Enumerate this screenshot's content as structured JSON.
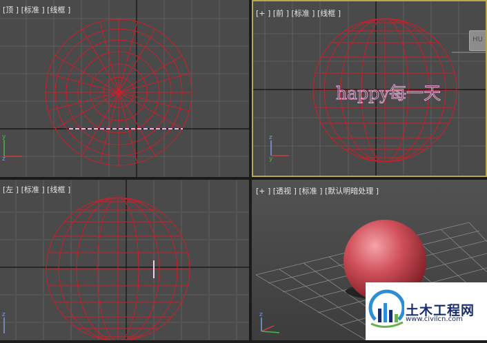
{
  "viewports": {
    "top": {
      "label": "[顶 ] [标准 ] [线框 ]"
    },
    "front": {
      "label": "[+ ] [前 ] [标准 ] [线框 ]",
      "text_object": "happy每一天"
    },
    "left": {
      "label": "[左 ] [标准 ] [线框 ]"
    },
    "persp": {
      "label": "[+ ] [透视 ] [标准 ] [默认明暗处理 ]"
    }
  },
  "colors": {
    "viewport_bg": "#4a4a4a",
    "grid": "#5d5d5d",
    "axis_line": "#101010",
    "wire": "#cc1f2a",
    "active_border": "#b7a84e",
    "text_object": "#f0a6d8",
    "sphere_shade": "#d0505a"
  },
  "icons": {
    "axis_tripod": "axis-tripod-icon",
    "viewcube": "viewcube-icon",
    "logo": "civilcn-logo-icon"
  },
  "watermark": {
    "title": "土木工程网",
    "url": "www.civilcn.com"
  }
}
